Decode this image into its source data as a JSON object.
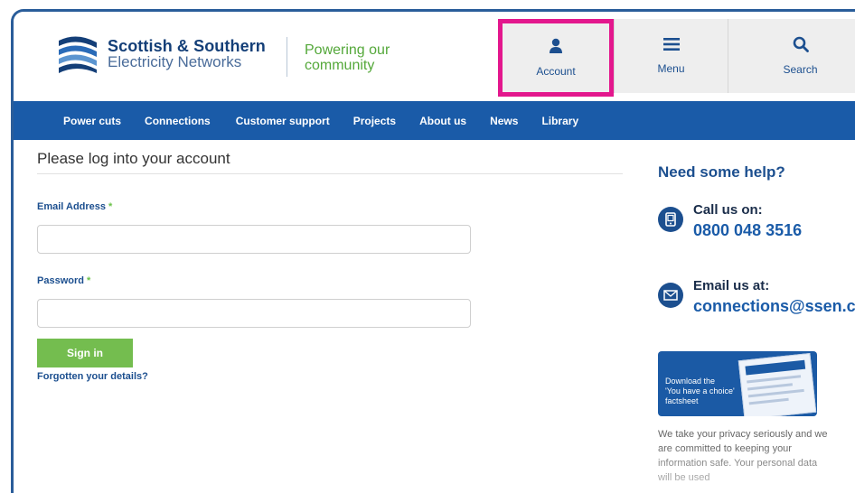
{
  "brand": {
    "name_line1": "Scottish & Southern",
    "name_line2": "Electricity Networks",
    "tagline_line1": "Powering our",
    "tagline_line2": "community"
  },
  "header_buttons": {
    "account": "Account",
    "menu": "Menu",
    "search": "Search"
  },
  "nav": {
    "items": [
      "Power cuts",
      "Connections",
      "Customer support",
      "Projects",
      "About us",
      "News",
      "Library"
    ]
  },
  "form": {
    "heading": "Please log into your account",
    "email_label": "Email Address",
    "password_label": "Password",
    "required_marker": "*",
    "email_value": "",
    "password_value": "",
    "sign_in": "Sign in",
    "forgot": "Forgotten your details?"
  },
  "help": {
    "title": "Need some help?",
    "call_label": "Call us on:",
    "phone": "0800 048 3516",
    "email_label": "Email us at:",
    "email": "connections@ssen.co"
  },
  "promo": {
    "line1": "Download the",
    "line2": "'You have a choice'",
    "line3": "factsheet"
  },
  "privacy": {
    "text": "We take your privacy seriously and we are committed to keeping your information safe. Your personal data will be used"
  },
  "colors": {
    "brand_blue": "#1a5ba8",
    "accent_green": "#74bd4f",
    "highlight_pink": "#e3178d"
  }
}
